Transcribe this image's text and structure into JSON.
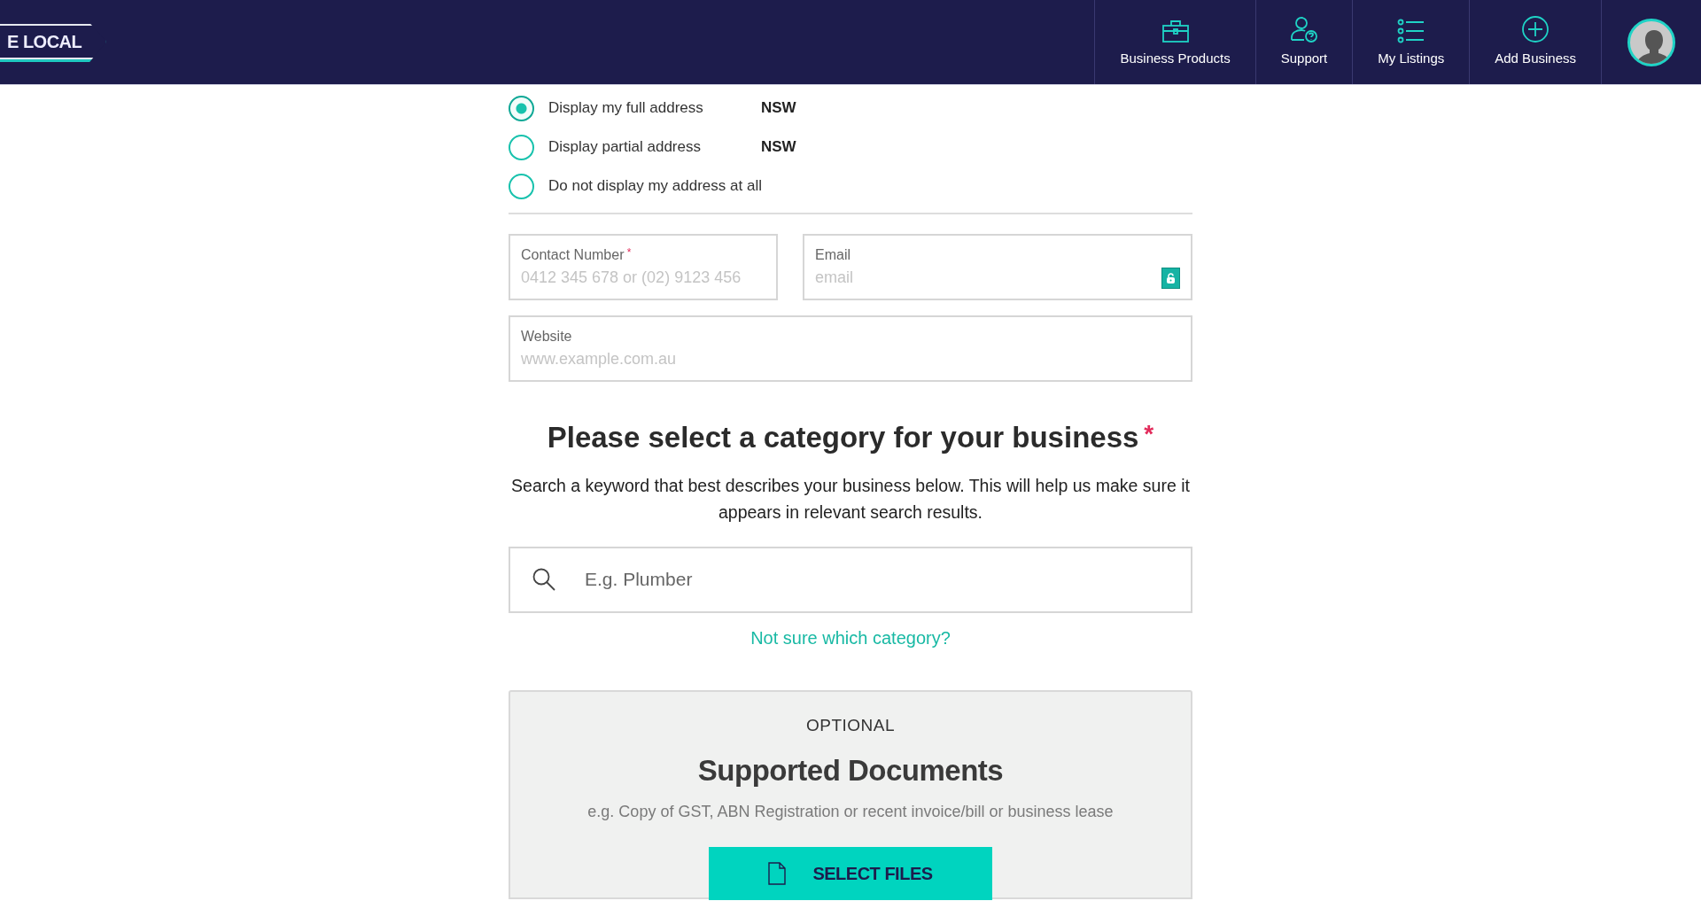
{
  "header": {
    "logo_text": "E LOCAL",
    "nav": [
      {
        "label": "Business Products"
      },
      {
        "label": "Support"
      },
      {
        "label": "My Listings"
      },
      {
        "label": "Add Business"
      }
    ]
  },
  "address_options": [
    {
      "label": "Display my full address",
      "value": "NSW",
      "selected": true
    },
    {
      "label": "Display partial address",
      "value": "NSW",
      "selected": false
    },
    {
      "label": "Do not display my address at all",
      "selected": false
    }
  ],
  "fields": [
    {
      "label": "Contact Number",
      "required_mark": "*",
      "placeholder": "0412 345 678 or (02) 9123 456"
    },
    {
      "label": "Email",
      "placeholder": "email",
      "lock": true
    },
    {
      "label": "Website",
      "placeholder": "www.example.com.au"
    }
  ],
  "category": {
    "title": "Please select a category for your business",
    "required_mark": "*",
    "description": "Search a keyword that best describes your business below. This will help us make sure it appears in relevant search results.",
    "search_placeholder": "E.g. Plumber",
    "help_link": "Not sure which category?"
  },
  "documents": {
    "kicker": "OPTIONAL",
    "title": "Supported Documents",
    "description": "e.g. Copy of GST, ABN Registration or recent invoice/bill or business lease",
    "button": "SELECT FILES"
  }
}
